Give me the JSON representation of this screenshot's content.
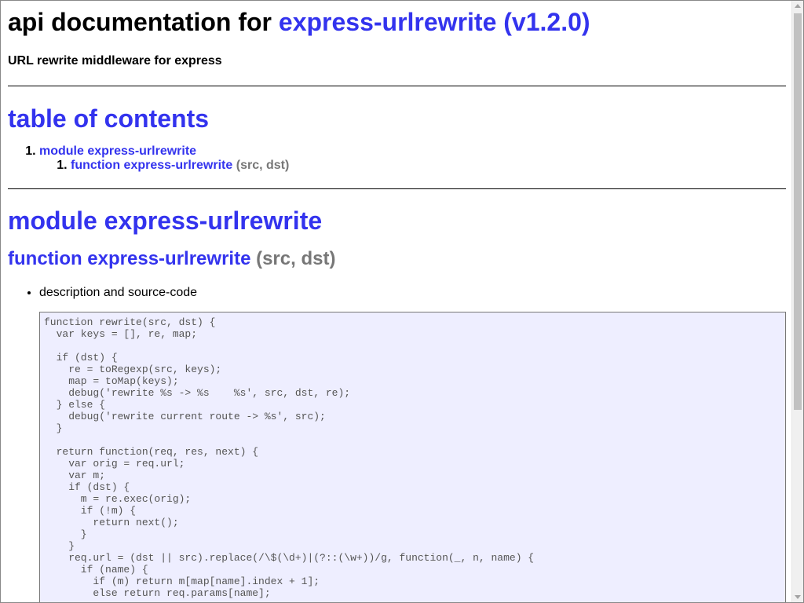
{
  "header": {
    "prefix": "api documentation for ",
    "package_link": "express-urlrewrite (v1.2.0)",
    "description": "URL rewrite middleware for express"
  },
  "toc": {
    "title": "table of contents",
    "module_number": "1.",
    "module_label": "module express-urlrewrite",
    "function_number": "1.",
    "function_label": "function express-urlrewrite",
    "function_sig": "(src, dst)"
  },
  "module": {
    "title": "module express-urlrewrite"
  },
  "function": {
    "title": "function express-urlrewrite",
    "sig": "(src, dst)",
    "bullet_label": "description and source-code",
    "code": "function rewrite(src, dst) {\n  var keys = [], re, map;\n\n  if (dst) {\n    re = toRegexp(src, keys);\n    map = toMap(keys);\n    debug('rewrite %s -> %s    %s', src, dst, re);\n  } else {\n    debug('rewrite current route -> %s', src);\n  }\n\n  return function(req, res, next) {\n    var orig = req.url;\n    var m;\n    if (dst) {\n      m = re.exec(orig);\n      if (!m) {\n        return next();\n      }\n    }\n    req.url = (dst || src).replace(/\\$(\\d+)|(?::(\\w+))/g, function(_, n, name) {\n      if (name) {\n        if (m) return m[map[name].index + 1];\n        else return req.params[name];"
  },
  "colors": {
    "link": "#3333ee",
    "signature": "#777777",
    "code_background": "#eeeeff"
  }
}
